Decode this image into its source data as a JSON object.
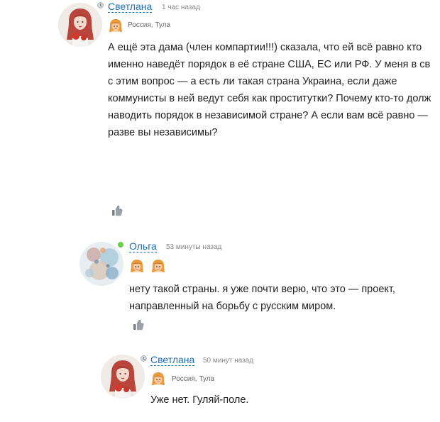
{
  "comments": [
    {
      "author": "Светлана",
      "time": "1 час назад",
      "location": "Россия, Тула",
      "badges": [
        "girl-badge-icon"
      ],
      "status": "away",
      "text_lines": [
        "А ещё эта дама (член компартии!!!) сказала, что ей всё равно кто",
        "именно наведёт порядок в её стране США, ЕС или РФ. У меня в св",
        "с этим вопрос — а есть ли такая страна Украина, если даже",
        "коммунисты в ней ведут себя как проститутки? Почему кто-то долж",
        "наводить порядок в независимой стране? А если вам всё равно —",
        "разве вы независимы?"
      ]
    },
    {
      "author": "Ольга",
      "time": "53 минуты назад",
      "location": "",
      "badges": [
        "girl-badge-icon",
        "girl-badge-icon"
      ],
      "status": "online",
      "text_lines": [
        "нету такой страны. я уже почти верю, что это — проект,",
        "направленный на борьбу с русским миром."
      ]
    },
    {
      "author": "Светлана",
      "time": "50 минут назад",
      "location": "Россия, Тула",
      "badges": [
        "girl-badge-icon"
      ],
      "status": "away",
      "text_lines": [
        "Уже нет. Гуляй-поле."
      ]
    }
  ],
  "colors": {
    "author_link": "#1f6fb0",
    "online": "#6ad04a",
    "muted_text": "#888888"
  }
}
